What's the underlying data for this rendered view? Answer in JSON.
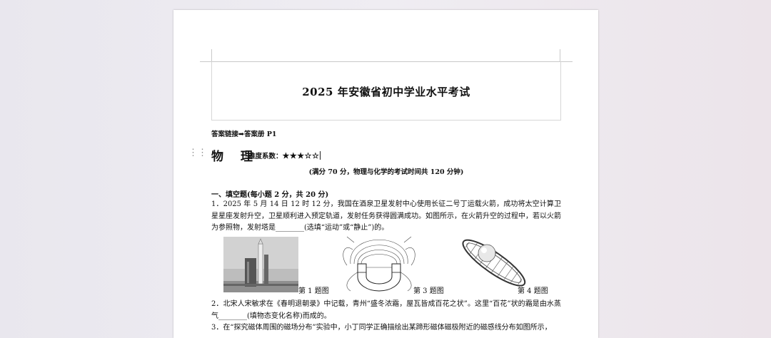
{
  "document": {
    "title": "2025 年安徽省初中学业水平考试",
    "answer_link": "答案链接➡答案册 P1",
    "subject": "物 理",
    "difficulty_label": "难度系数：",
    "difficulty_stars": "★★★☆☆",
    "exam_note": "(满分 70 分，物理与化学的考试时间共 120 分钟)",
    "section_title": "一、填空题(每小题 2 分，共 20 分)",
    "questions": [
      {
        "text": "1．2025 年 5 月 14 日 12 时 12 分，我国在酒泉卫星发射中心使用长征二号丁运载火箭，成功将太空计算卫星星座发射升空，卫星顺利进入预定轨道，发射任务获得圆满成功。如图所示，在火箭升空的过程中，若以火箭为参照物，发射塔是________(选填“运动”或“静止”)的。"
      },
      {
        "text": "2．北宋人宋敏求在《春明退朝录》中记载，青州“盛冬浓霜，屋瓦皆成百花之状”。这里“百花”状的霜是由水蒸气________(填物态变化名称)而成的。"
      },
      {
        "text": "3．在“探究磁体周围的磁场分布”实验中，小丁同学正确描绘出某蹄形磁体磁极附近的磁感线分布如图所示，"
      }
    ],
    "figure_captions": [
      "第 1 题图",
      "第 3 题图",
      "第 4 题图"
    ]
  },
  "colors": {
    "background_left": "#e9e7ee",
    "background_right": "#ece4ea",
    "page": "#ffffff"
  },
  "icons": [
    "drag-handle-icon"
  ]
}
